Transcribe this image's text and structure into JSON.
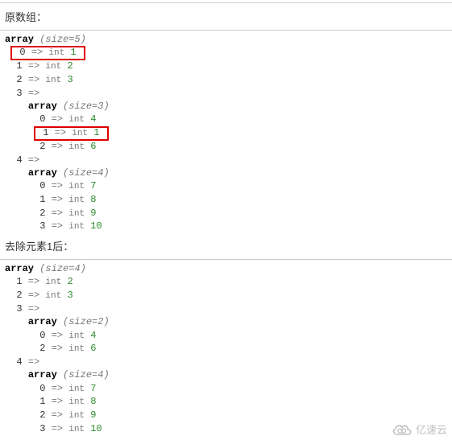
{
  "section1_title": "原数组：",
  "section2_title": "去除元素1后：",
  "a1": {
    "size": 5,
    "items": [
      {
        "key": 0,
        "val": 1,
        "boxed": true
      },
      {
        "key": 1,
        "val": 2
      },
      {
        "key": 2,
        "val": 3
      },
      {
        "key": 3,
        "type": "array",
        "size": 3,
        "children": [
          {
            "key": 0,
            "val": 4
          },
          {
            "key": 1,
            "val": 1,
            "boxed": true
          },
          {
            "key": 2,
            "val": 6
          }
        ]
      },
      {
        "key": 4,
        "type": "array",
        "size": 4,
        "children": [
          {
            "key": 0,
            "val": 7
          },
          {
            "key": 1,
            "val": 8
          },
          {
            "key": 2,
            "val": 9
          },
          {
            "key": 3,
            "val": 10
          }
        ]
      }
    ]
  },
  "a2": {
    "size": 4,
    "items": [
      {
        "key": 1,
        "val": 2
      },
      {
        "key": 2,
        "val": 3
      },
      {
        "key": 3,
        "type": "array",
        "size": 2,
        "children": [
          {
            "key": 0,
            "val": 4
          },
          {
            "key": 2,
            "val": 6
          }
        ]
      },
      {
        "key": 4,
        "type": "array",
        "size": 4,
        "children": [
          {
            "key": 0,
            "val": 7
          },
          {
            "key": 1,
            "val": 8
          },
          {
            "key": 2,
            "val": 9
          },
          {
            "key": 3,
            "val": 10
          }
        ]
      }
    ]
  },
  "labels": {
    "array": "array",
    "size_prefix": "(size=",
    "size_suffix": ")",
    "arrow": "=>",
    "int": "int"
  },
  "watermark": "亿速云"
}
